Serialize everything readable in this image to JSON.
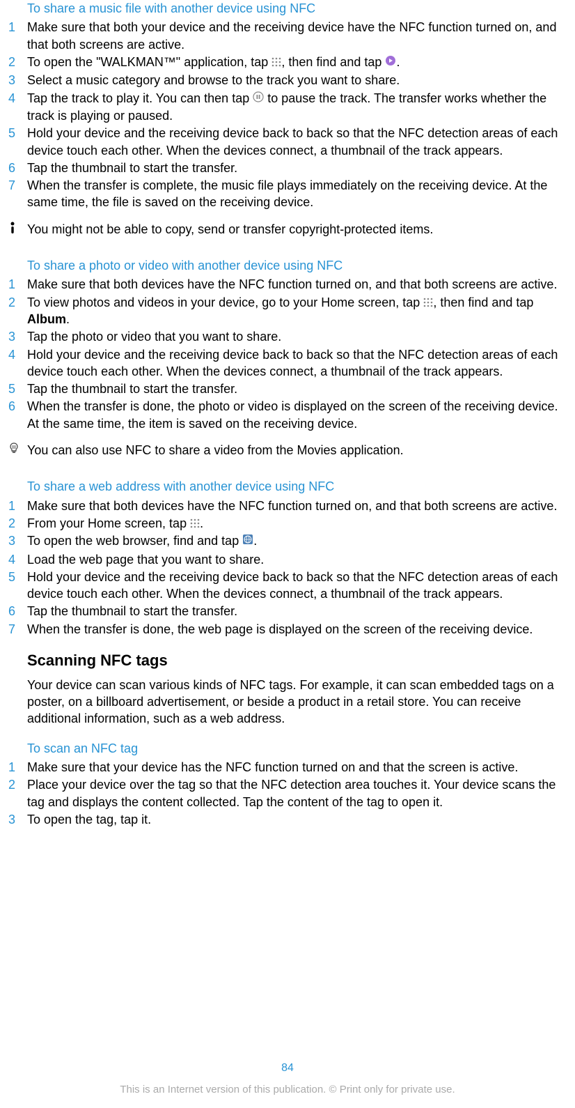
{
  "section1": {
    "heading": "To share a music file with another device using NFC",
    "steps": [
      "Make sure that both your device and the receiving device have the NFC function turned on, and that both screens are active.",
      "To open the \"WALKMAN™\" application, tap",
      "Select a music category and browse to the track you want to share.",
      "Tap the track to play it. You can then tap",
      "Hold your device and the receiving device back to back so that the NFC detection areas of each device touch each other. When the devices connect, a thumbnail of the track appears.",
      "Tap the thumbnail to start the transfer.",
      "When the transfer is complete, the music file plays immediately on the receiving device. At the same time, the file is saved on the receiving device."
    ],
    "step2_mid": ", then find and tap",
    "step2_end": ".",
    "step4_end": " to pause the track. The transfer works whether the track is playing or paused.",
    "note": "You might not be able to copy, send or transfer copyright-protected items."
  },
  "section2": {
    "heading": "To share a photo or video with another device using NFC",
    "steps": [
      "Make sure that both devices have the NFC function turned on, and that both screens are active.",
      "To view photos and videos in your device, go to your Home screen, tap",
      "Tap the photo or video that you want to share.",
      "Hold your device and the receiving device back to back so that the NFC detection areas of each device touch each other. When the devices connect, a thumbnail of the track appears.",
      "Tap the thumbnail to start the transfer.",
      "When the transfer is done, the photo or video is displayed on the screen of the receiving device. At the same time, the item is saved on the receiving device."
    ],
    "step2_mid": ", then find and tap ",
    "step2_album": "Album",
    "step2_end": ".",
    "tip": "You can also use NFC to share a video from the Movies application."
  },
  "section3": {
    "heading": "To share a web address with another device using NFC",
    "steps": [
      "Make sure that both devices have the NFC function turned on, and that both screens are active.",
      "From your Home screen, tap",
      "To open the web browser, find and tap",
      "Load the web page that you want to share.",
      "Hold your device and the receiving device back to back so that the NFC detection areas of each device touch each other. When the devices connect, a thumbnail of the track appears.",
      "Tap the thumbnail to start the transfer.",
      "When the transfer is done, the web page is displayed on the screen of the receiving device."
    ],
    "step2_end": ".",
    "step3_end": "."
  },
  "section4": {
    "heading": "Scanning NFC tags",
    "body": "Your device can scan various kinds of NFC tags. For example, it can scan embedded tags on a poster, on a billboard advertisement, or beside a product in a retail store. You can receive additional information, such as a web address."
  },
  "section5": {
    "heading": "To scan an NFC tag",
    "steps": [
      "Make sure that your device has the NFC function turned on and that the screen is active.",
      "Place your device over the tag so that the NFC detection area touches it. Your device scans the tag and displays the content collected. Tap the content of the tag to open it.",
      "To open the tag, tap it."
    ]
  },
  "page_number": "84",
  "footer": "This is an Internet version of this publication. © Print only for private use."
}
